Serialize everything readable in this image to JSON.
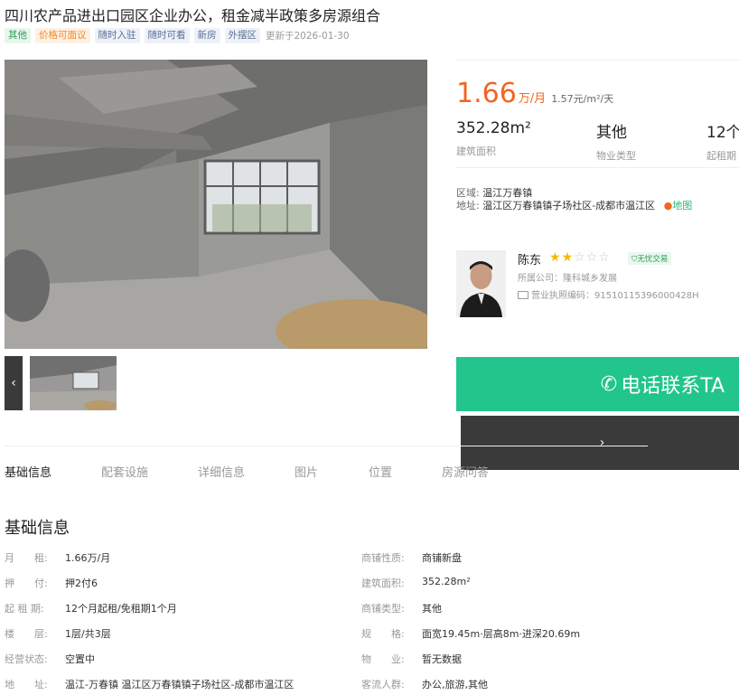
{
  "title": "四川农产品进出口园区企业办公，租金减半政策多房源组合",
  "tags": [
    {
      "label": "其他",
      "color": "green"
    },
    {
      "label": "价格可面议",
      "color": "orange"
    },
    {
      "label": "随时入驻",
      "color": "blue"
    },
    {
      "label": "随时可看",
      "color": "blue"
    },
    {
      "label": "新房",
      "color": "blue"
    },
    {
      "label": "外摆区",
      "color": "blue"
    }
  ],
  "updated": "更新于2026-01-30",
  "gallery": {
    "prev": "‹",
    "next": "›"
  },
  "price": {
    "value": "1.66",
    "unit": "万/月",
    "per_unit": "1.57元/m²/天"
  },
  "stats": [
    {
      "value": "352.28m²",
      "label": "建筑面积"
    },
    {
      "value": "其他",
      "label": "物业类型"
    },
    {
      "value": "12个",
      "label": "起租期"
    }
  ],
  "location": {
    "region_label": "区域:",
    "region": "温江万春镇",
    "address_label": "地址:",
    "address": "温江区万春镇镇子场社区-成都市温江区",
    "map_link": "地图"
  },
  "agent": {
    "name": "陈东",
    "rating": 2,
    "rating_max": 5,
    "badge": "无忧交易",
    "company": "所属公司：隆科城乡发展",
    "license": "营业执照编码：91510115396000428H"
  },
  "call_button": "电话联系TA",
  "tabs": [
    "基础信息",
    "配套设施",
    "详细信息",
    "图片",
    "位置",
    "房源问答"
  ],
  "basic": {
    "title": "基础信息",
    "left": [
      {
        "k": "月　　租:",
        "v": "1.66万/月"
      },
      {
        "k": "押　　付:",
        "v": "押2付6"
      },
      {
        "k": "起 租 期:",
        "v": "12个月起租/免租期1个月"
      },
      {
        "k": "楼　　层:",
        "v": "1层/共3层"
      },
      {
        "k": "经营状态:",
        "v": "空置中"
      },
      {
        "k": "地　　址:",
        "v": "温江-万春镇 温江区万春镇镇子场社区-成都市温江区"
      }
    ],
    "right": [
      {
        "k": "商铺性质:",
        "v": "商铺新盘"
      },
      {
        "k": "建筑面积:",
        "v": "352.28m²"
      },
      {
        "k": "商铺类型:",
        "v": "其他"
      },
      {
        "k": "规　　格:",
        "v": "面宽19.45m·层高8m·进深20.69m"
      },
      {
        "k": "物　　业:",
        "v": "暂无数据"
      },
      {
        "k": "客流人群:",
        "v": "办公,旅游,其他"
      }
    ]
  }
}
